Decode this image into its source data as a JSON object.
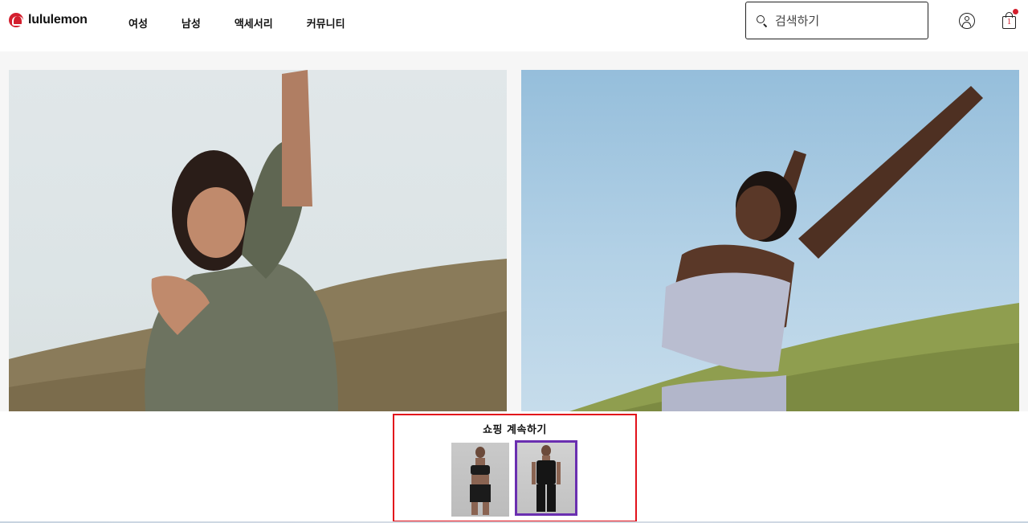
{
  "brand": {
    "name": "lululemon",
    "logo_color": "#d31f2e"
  },
  "nav": [
    {
      "label": "여성"
    },
    {
      "label": "남성"
    },
    {
      "label": "액세서리"
    },
    {
      "label": "커뮤니티"
    }
  ],
  "search": {
    "placeholder": "검색하기",
    "icon": "search-icon"
  },
  "header_icons": {
    "account": "account-icon",
    "bag": "shopping-bag-icon",
    "bag_count": "1"
  },
  "hero": {
    "images": [
      {
        "name": "hero-image-woman-olive-top",
        "icon": "photo"
      },
      {
        "name": "hero-image-woman-lavender-bra",
        "icon": "photo"
      }
    ]
  },
  "continue_shopping": {
    "title": "쇼핑 계속하기",
    "items": [
      {
        "name": "product-thumbnail-bra-shorts",
        "selected": false
      },
      {
        "name": "product-thumbnail-tank-leggings",
        "selected": true
      }
    ],
    "highlight_color": "#e2111b",
    "selected_color": "#6a2fb0"
  }
}
